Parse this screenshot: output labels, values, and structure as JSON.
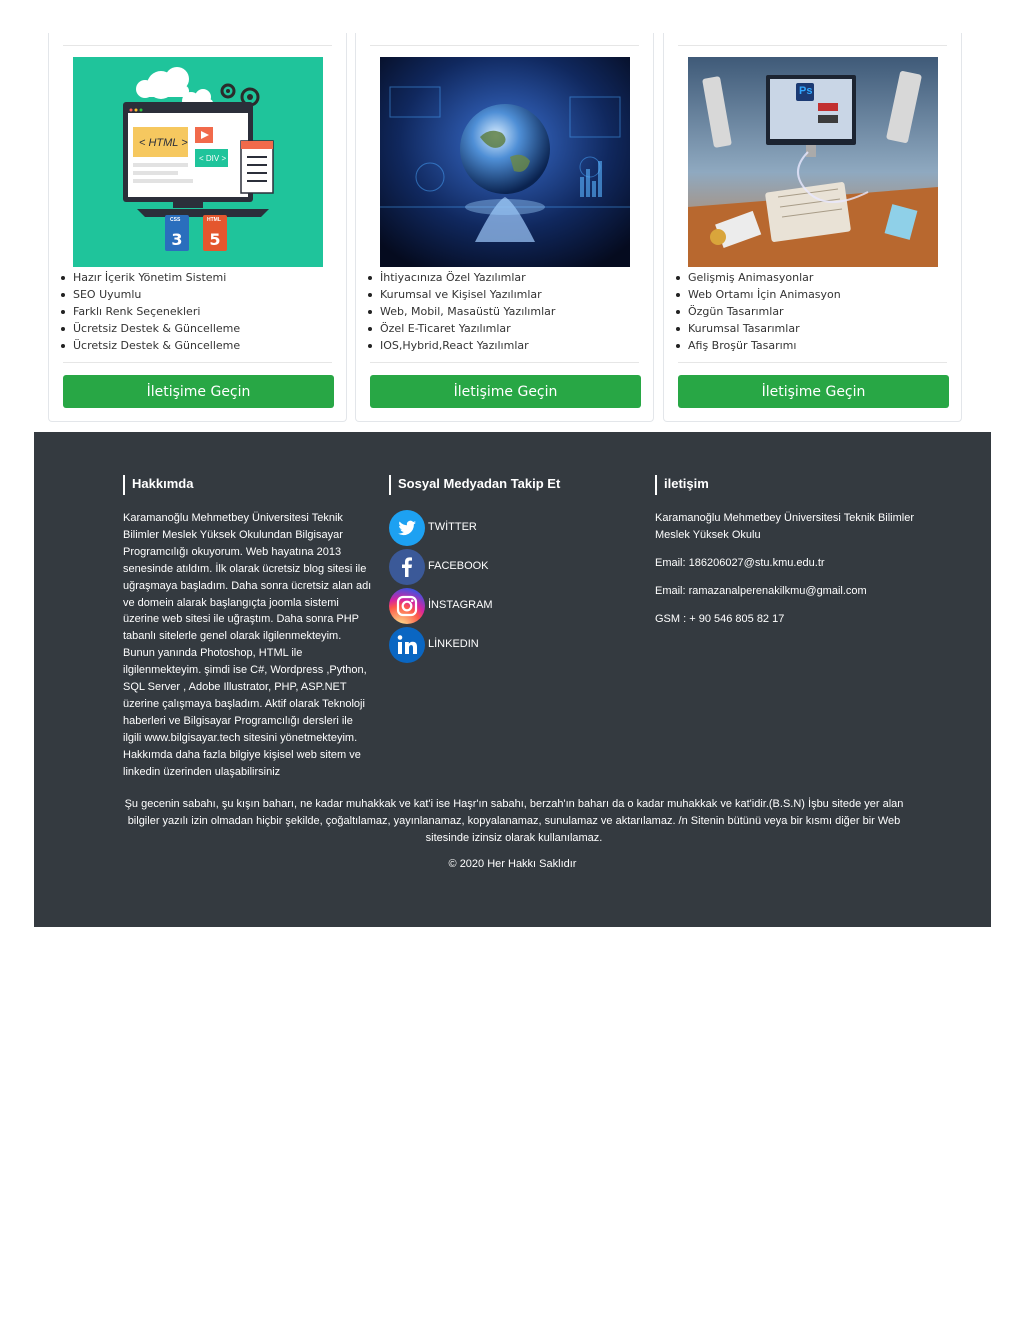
{
  "cards": [
    {
      "features": [
        "Hazır İçerik Yönetim Sistemi",
        "SEO Uyumlu",
        "Farklı Renk Seçenekleri",
        "Ücretsiz Destek & Güncelleme",
        "Ücretsiz Destek & Güncelleme"
      ],
      "button": "İletişime Geçin",
      "illustration": {
        "html_tag": "< HTML >",
        "div_tag": "< DIV >",
        "css_badge": "CSS",
        "html_badge": "HTML"
      }
    },
    {
      "features": [
        "İhtiyacınıza Özel Yazılımlar",
        "Kurumsal ve Kişisel Yazılımlar",
        "Web, Mobil, Masaüstü Yazılımlar",
        "Özel E-Ticaret Yazılımlar",
        "IOS,Hybrid,React Yazılımlar"
      ],
      "button": "İletişime Geçin"
    },
    {
      "features": [
        "Gelişmiş Animasyonlar",
        "Web Ortamı İçin Animasyon",
        "Özgün Tasarımlar",
        "Kurumsal Tasarımlar",
        "Afiş Broşür Tasarımı"
      ],
      "button": "İletişime Geçin",
      "illustration": {
        "ps_badge": "Ps"
      }
    }
  ],
  "footer": {
    "about": {
      "title": "Hakkımda",
      "text": "Karamanoğlu Mehmetbey Üniversitesi Teknik Bilimler Meslek Yüksek Okulundan Bilgisayar Programcılığı okuyorum. Web hayatına 2013 senesinde atıldım. İlk olarak ücretsiz blog sitesi ile uğraşmaya başladım. Daha sonra ücretsiz alan adı ve domein alarak başlangıçta joomla sistemi üzerine web sitesi ile uğraştım. Daha sonra PHP tabanlı sitelerle genel olarak ilgilenmekteyim. Bunun yanında Photoshop, HTML ile ilgilenmekteyim. şimdi ise C#, Wordpress ,Python, SQL Server , Adobe Illustrator, PHP, ASP.NET üzerine çalışmaya başladım. Aktif olarak Teknoloji haberleri ve Bilgisayar Programcılığı dersleri ile ilgili www.bilgisayar.tech sitesini yönetmekteyim. Hakkımda daha fazla bilgiye kişisel web sitem ve linkedin üzerinden ulaşabilirsiniz"
    },
    "social": {
      "title": "Sosyal Medyadan Takip Et",
      "items": [
        {
          "label": "TWİTTER",
          "icon": "twitter-icon",
          "color": "#1da1f2"
        },
        {
          "label": "FACEBOOK",
          "icon": "facebook-icon",
          "color": "#3b5998"
        },
        {
          "label": "İNSTAGRAM",
          "icon": "instagram-icon",
          "color": "#e1306c"
        },
        {
          "label": "LİNKEDIN",
          "icon": "linkedin-icon",
          "color": "#0a66c2"
        }
      ]
    },
    "contact": {
      "title": "iletişim",
      "school": "Karamanoğlu Mehmetbey Üniversitesi Teknik Bilimler Meslek Yüksek Okulu",
      "email1": "Email: 186206027@stu.kmu.edu.tr",
      "email2": "Email: ramazanalperenakilkmu@gmail.com",
      "phone": "GSM : + 90 546 805 82 17"
    },
    "legal": "Şu gecenin sabahı, şu kışın baharı, ne kadar muhakkak ve kat'i ise Haşr'ın sabahı, berzah'ın baharı da o kadar muhakkak ve kat'idir.(B.S.N) İşbu sitede yer alan bilgiler yazılı izin olmadan hiçbir şekilde, çoğaltılamaz, yayınlanamaz, kopyalanamaz, sunulamaz ve aktarılamaz. /n Sitenin bütünü veya bir kısmı diğer bir Web sitesinde izinsiz olarak kullanılamaz.",
    "copyright": "© 2020 Her Hakkı Saklıdır"
  },
  "colors": {
    "button": "#28a745",
    "footer_bg": "#343a40",
    "card1_bg": "#1fc49b"
  }
}
